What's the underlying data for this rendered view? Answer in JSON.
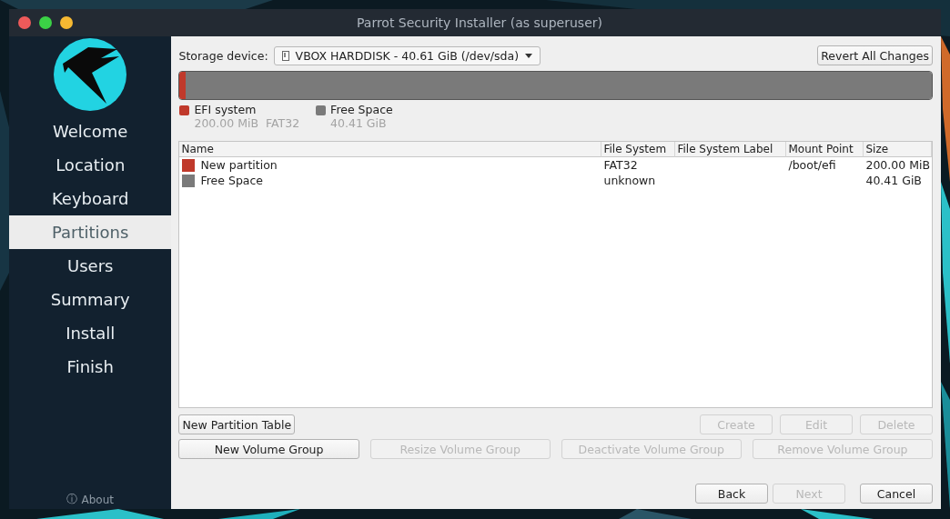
{
  "window": {
    "title": "Parrot Security Installer (as superuser)"
  },
  "sidebar": {
    "items": [
      {
        "label": "Welcome",
        "selected": false
      },
      {
        "label": "Location",
        "selected": false
      },
      {
        "label": "Keyboard",
        "selected": false
      },
      {
        "label": "Partitions",
        "selected": true
      },
      {
        "label": "Users",
        "selected": false
      },
      {
        "label": "Summary",
        "selected": false
      },
      {
        "label": "Install",
        "selected": false
      },
      {
        "label": "Finish",
        "selected": false
      }
    ],
    "about": {
      "icon": "ⓘ",
      "label": "About"
    }
  },
  "storage": {
    "label": "Storage device:",
    "device": "VBOX HARDDISK - 40.61 GiB (/dev/sda)",
    "revert_button": "Revert All Changes"
  },
  "partitions": [
    {
      "name": "EFI system",
      "details": "200.00 MiB  FAT32",
      "color": "#c0392b",
      "level": 0.008
    },
    {
      "name": "Free Space",
      "details": "40.41 GiB",
      "color": "#7a7a7a",
      "level": 0.992
    }
  ],
  "table": {
    "columns": [
      "Name",
      "File System",
      "File System Label",
      "Mount Point",
      "Size"
    ],
    "rows": [
      {
        "color": "#c0392b",
        "cells": [
          "New partition",
          "FAT32",
          "",
          "/boot/efi",
          "200.00 MiB"
        ]
      },
      {
        "color": "#7a7a7a",
        "cells": [
          "Free Space",
          "unknown",
          "",
          "",
          "40.41 GiB"
        ]
      }
    ]
  },
  "partition_buttons": [
    {
      "label": "New Partition Table",
      "disabled": false
    },
    {
      "label": "Create",
      "disabled": true
    },
    {
      "label": "Edit",
      "disabled": true
    },
    {
      "label": "Delete",
      "disabled": true
    }
  ],
  "volume_buttons": [
    {
      "label": "New Volume Group",
      "disabled": false
    },
    {
      "label": "Resize Volume Group",
      "disabled": true
    },
    {
      "label": "Deactivate Volume Group",
      "disabled": true
    },
    {
      "label": "Remove Volume Group",
      "disabled": true
    }
  ],
  "nav_buttons": [
    {
      "label": "Back",
      "disabled": false
    },
    {
      "label": "Next",
      "disabled": true
    },
    {
      "label": "Cancel",
      "disabled": false
    }
  ]
}
